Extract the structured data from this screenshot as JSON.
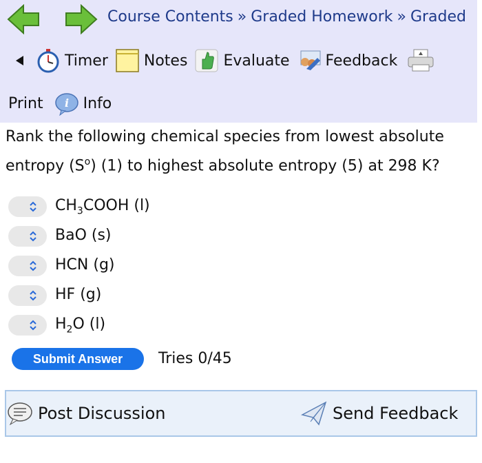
{
  "nav": {
    "breadcrumbs": [
      "Course Contents",
      "Graded Homework",
      "Graded"
    ],
    "separator": "»"
  },
  "toolbar": {
    "timer_label": "Timer",
    "notes_label": "Notes",
    "evaluate_label": "Evaluate",
    "feedback_label": "Feedback",
    "print_label": "Print",
    "info_label": "Info"
  },
  "question": {
    "text_part1": "Rank the following chemical species from lowest absolute entropy (S",
    "sup": "o",
    "text_part2": ") (1) to highest absolute entropy (5) at 298 K?"
  },
  "items": [
    {
      "pre": "CH",
      "sub": "3",
      "post": "COOH (l)"
    },
    {
      "pre": "BaO (s)",
      "sub": "",
      "post": ""
    },
    {
      "pre": "HCN (g)",
      "sub": "",
      "post": ""
    },
    {
      "pre": "HF (g)",
      "sub": "",
      "post": ""
    },
    {
      "pre": "H",
      "sub": "2",
      "post": "O (l)"
    }
  ],
  "submit_label": "Submit Answer",
  "tries_text": "Tries 0/45",
  "footer": {
    "post_discussion_label": "Post Discussion",
    "send_feedback_label": "Send Feedback"
  },
  "colors": {
    "header_bg": "#e6e6fa",
    "link": "#1e3a8a",
    "submit_bg": "#1a73e8",
    "footer_border": "#a9c7e8"
  },
  "icons": [
    "back-arrow-icon",
    "forward-arrow-icon",
    "collapse-arrow-icon",
    "timer-icon",
    "notes-icon",
    "evaluate-icon",
    "feedback-icon",
    "printer-icon",
    "info-icon",
    "chevron-updown-icon",
    "discussion-icon",
    "send-feedback-icon"
  ]
}
